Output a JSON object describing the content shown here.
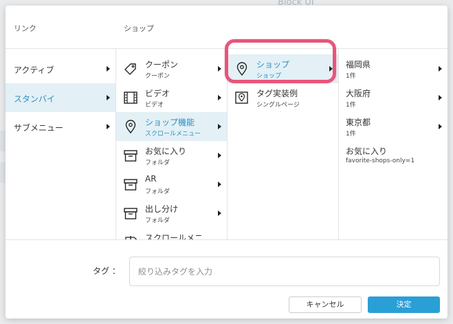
{
  "background": {
    "text": "Block UI"
  },
  "headers": {
    "link": "リンク",
    "shop": "ショップ"
  },
  "col1": [
    {
      "label": "アクティブ",
      "active": false
    },
    {
      "label": "スタンバイ",
      "active": true
    },
    {
      "label": "サブメニュー",
      "active": false
    }
  ],
  "col2": [
    {
      "icon": "coupon-tag-icon",
      "label": "クーポン",
      "sub": "クーポン"
    },
    {
      "icon": "video-film-icon",
      "label": "ビデオ",
      "sub": "ビデオ"
    },
    {
      "icon": "location-pin-icon",
      "label": "ショップ機能",
      "sub": "スクロールメニュー",
      "active": true
    },
    {
      "icon": "archive-box-icon",
      "label": "お気に入り",
      "sub": "フォルダ"
    },
    {
      "icon": "archive-box-icon",
      "label": "AR",
      "sub": "フォルダ"
    },
    {
      "icon": "archive-box-icon",
      "label": "出し分け",
      "sub": "フォルダ"
    },
    {
      "icon": "signpost-icon",
      "label": "スクロールメニ…",
      "sub": ""
    }
  ],
  "col3": [
    {
      "icon": "location-pin-icon",
      "label": "ショップ",
      "sub": "ショップ",
      "active": true
    },
    {
      "icon": "map-document-icon",
      "label": "タグ実装例",
      "sub": "シングルページ"
    }
  ],
  "col4": [
    {
      "label": "福岡県",
      "sub": "1件",
      "arrow": true
    },
    {
      "label": "大阪府",
      "sub": "1件",
      "arrow": true
    },
    {
      "label": "東京都",
      "sub": "1件",
      "arrow": true
    },
    {
      "label": "お気に入り",
      "sub": "favorite-shops-only=1",
      "arrow": false
    }
  ],
  "tag": {
    "label": "タグ ：",
    "placeholder": "絞り込みタグを入力",
    "value": ""
  },
  "buttons": {
    "cancel": "キャンセル",
    "ok": "決定"
  },
  "colors": {
    "accent": "#2a9fd6",
    "active_bg": "#e3f0f6",
    "active_text": "#2a8fc0",
    "highlight": "#e8557a"
  }
}
